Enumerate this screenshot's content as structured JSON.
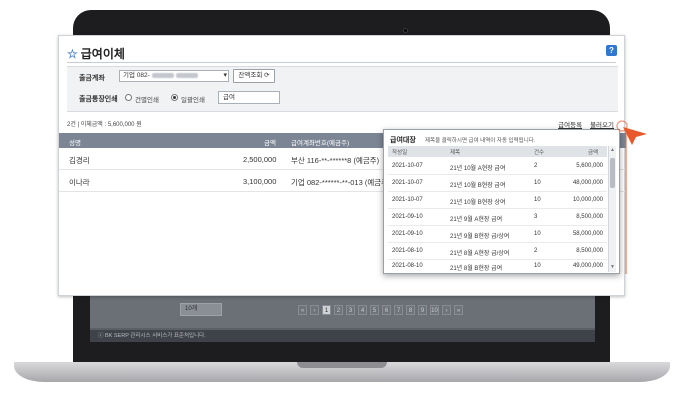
{
  "background": {
    "page_select": "10개",
    "pager": [
      "«",
      "‹",
      "1",
      "2",
      "3",
      "4",
      "5",
      "6",
      "7",
      "8",
      "9",
      "10",
      "›",
      "»"
    ],
    "footer": "ⓒ BK SERP 관리시스 서비스가 표준처입니다."
  },
  "panel": {
    "title": "급여이체",
    "help_label": "?",
    "form": {
      "account_label": "출금계좌",
      "account_value": "기업 082-",
      "lookup_button": "잔액조회",
      "print_label": "출금통장인쇄",
      "radio_individual": "건별인쇄",
      "radio_bulk": "일괄인쇄",
      "print_text": "급여"
    },
    "summary": "2건 | 이체금액 : 5,600,000 원",
    "links": {
      "register": "급여등록",
      "load": "불러오기"
    },
    "table": {
      "headers": [
        "성명",
        "금액",
        "급여계좌번호(예금주)"
      ],
      "rows": [
        {
          "name": "김경리",
          "amount": "2,500,000",
          "account": "부산 116-**-******8 (예금주)"
        },
        {
          "name": "이나라",
          "amount": "3,100,000",
          "account": "기업 082-******-**-013 (예금주)"
        }
      ]
    }
  },
  "popup": {
    "title": "급여대장",
    "description": "제목을 클릭하시면 급여 내역이 자동 입력됩니다.",
    "headers": [
      "작성일",
      "제목",
      "건수",
      "금액"
    ],
    "rows": [
      {
        "date": "2021-10-07",
        "subject": "21년 10월 A현장 급여",
        "count": "2",
        "amount": "5,600,000"
      },
      {
        "date": "2021-10-07",
        "subject": "21년 10월 B현장 급여",
        "count": "10",
        "amount": "48,000,000"
      },
      {
        "date": "2021-10-07",
        "subject": "21년 10월 B현장 상여",
        "count": "10",
        "amount": "10,000,000"
      },
      {
        "date": "2021-09-10",
        "subject": "21년 9월 A현장 급여",
        "count": "3",
        "amount": "8,500,000"
      },
      {
        "date": "2021-09-10",
        "subject": "21년 9월 B현장 급/상여",
        "count": "10",
        "amount": "58,000,000"
      },
      {
        "date": "2021-08-10",
        "subject": "21년 8월 A현장 급/상여",
        "count": "2",
        "amount": "8,500,000"
      },
      {
        "date": "2021-08-10",
        "subject": "21년 8월 B현장 급여",
        "count": "10",
        "amount": "49,000,000"
      }
    ]
  },
  "colors": {
    "header_bg": "#7c8594",
    "accent": "#2f77d1",
    "cursor": "#e8582a"
  }
}
